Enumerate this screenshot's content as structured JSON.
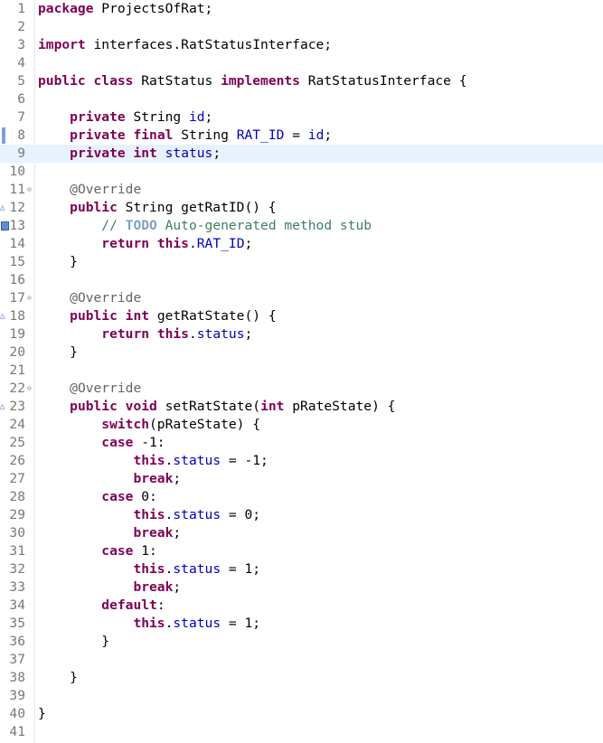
{
  "lines": [
    {
      "num": "1",
      "marker": "",
      "fold": "",
      "tokens": [
        {
          "t": "k",
          "v": "package"
        },
        {
          "t": "p",
          "v": " ProjectsOfRat;"
        }
      ]
    },
    {
      "num": "2",
      "marker": "",
      "fold": "",
      "tokens": []
    },
    {
      "num": "3",
      "marker": "",
      "fold": "",
      "tokens": [
        {
          "t": "k",
          "v": "import"
        },
        {
          "t": "p",
          "v": " interfaces.RatStatusInterface;"
        }
      ]
    },
    {
      "num": "4",
      "marker": "",
      "fold": "",
      "tokens": []
    },
    {
      "num": "5",
      "marker": "",
      "fold": "",
      "tokens": [
        {
          "t": "k",
          "v": "public"
        },
        {
          "t": "p",
          "v": " "
        },
        {
          "t": "k",
          "v": "class"
        },
        {
          "t": "p",
          "v": " RatStatus "
        },
        {
          "t": "k",
          "v": "implements"
        },
        {
          "t": "p",
          "v": " RatStatusInterface {"
        }
      ]
    },
    {
      "num": "6",
      "marker": "",
      "fold": "",
      "tokens": []
    },
    {
      "num": "7",
      "marker": "",
      "fold": "",
      "tokens": [
        {
          "t": "p",
          "v": "    "
        },
        {
          "t": "k",
          "v": "private"
        },
        {
          "t": "p",
          "v": " String "
        },
        {
          "t": "f",
          "v": "id"
        },
        {
          "t": "p",
          "v": ";"
        }
      ]
    },
    {
      "num": "8",
      "marker": "bookmark",
      "fold": "",
      "tokens": [
        {
          "t": "p",
          "v": "    "
        },
        {
          "t": "k",
          "v": "private"
        },
        {
          "t": "p",
          "v": " "
        },
        {
          "t": "k",
          "v": "final"
        },
        {
          "t": "p",
          "v": " String "
        },
        {
          "t": "f",
          "v": "RAT_ID"
        },
        {
          "t": "p",
          "v": " = "
        },
        {
          "t": "f",
          "v": "id"
        },
        {
          "t": "p",
          "v": ";"
        }
      ]
    },
    {
      "num": "9",
      "marker": "",
      "fold": "",
      "current": true,
      "tokens": [
        {
          "t": "p",
          "v": "    "
        },
        {
          "t": "k",
          "v": "private"
        },
        {
          "t": "p",
          "v": " "
        },
        {
          "t": "k",
          "v": "int"
        },
        {
          "t": "p",
          "v": " "
        },
        {
          "t": "f",
          "v": "status"
        },
        {
          "t": "p",
          "v": ";"
        }
      ]
    },
    {
      "num": "10",
      "marker": "",
      "fold": "",
      "tokens": []
    },
    {
      "num": "11",
      "marker": "",
      "fold": "⊖",
      "tokens": [
        {
          "t": "p",
          "v": "    "
        },
        {
          "t": "a",
          "v": "@Override"
        }
      ]
    },
    {
      "num": "12",
      "marker": "override",
      "fold": "",
      "tokens": [
        {
          "t": "p",
          "v": "    "
        },
        {
          "t": "k",
          "v": "public"
        },
        {
          "t": "p",
          "v": " String getRatID() {"
        }
      ]
    },
    {
      "num": "13",
      "marker": "todo",
      "fold": "",
      "tokens": [
        {
          "t": "p",
          "v": "        "
        },
        {
          "t": "c",
          "v": "// "
        },
        {
          "t": "t",
          "v": "TODO"
        },
        {
          "t": "c",
          "v": " Auto-generated method stub"
        }
      ]
    },
    {
      "num": "14",
      "marker": "",
      "fold": "",
      "tokens": [
        {
          "t": "p",
          "v": "        "
        },
        {
          "t": "k",
          "v": "return"
        },
        {
          "t": "p",
          "v": " "
        },
        {
          "t": "k",
          "v": "this"
        },
        {
          "t": "p",
          "v": "."
        },
        {
          "t": "f",
          "v": "RAT_ID"
        },
        {
          "t": "p",
          "v": ";"
        }
      ]
    },
    {
      "num": "15",
      "marker": "",
      "fold": "",
      "tokens": [
        {
          "t": "p",
          "v": "    }"
        }
      ]
    },
    {
      "num": "16",
      "marker": "",
      "fold": "",
      "tokens": []
    },
    {
      "num": "17",
      "marker": "",
      "fold": "⊖",
      "tokens": [
        {
          "t": "p",
          "v": "    "
        },
        {
          "t": "a",
          "v": "@Override"
        }
      ]
    },
    {
      "num": "18",
      "marker": "override",
      "fold": "",
      "tokens": [
        {
          "t": "p",
          "v": "    "
        },
        {
          "t": "k",
          "v": "public"
        },
        {
          "t": "p",
          "v": " "
        },
        {
          "t": "k",
          "v": "int"
        },
        {
          "t": "p",
          "v": " getRatState() {"
        }
      ]
    },
    {
      "num": "19",
      "marker": "",
      "fold": "",
      "tokens": [
        {
          "t": "p",
          "v": "        "
        },
        {
          "t": "k",
          "v": "return"
        },
        {
          "t": "p",
          "v": " "
        },
        {
          "t": "k",
          "v": "this"
        },
        {
          "t": "p",
          "v": "."
        },
        {
          "t": "f",
          "v": "status"
        },
        {
          "t": "p",
          "v": ";"
        }
      ]
    },
    {
      "num": "20",
      "marker": "",
      "fold": "",
      "tokens": [
        {
          "t": "p",
          "v": "    }"
        }
      ]
    },
    {
      "num": "21",
      "marker": "",
      "fold": "",
      "tokens": []
    },
    {
      "num": "22",
      "marker": "",
      "fold": "⊖",
      "tokens": [
        {
          "t": "p",
          "v": "    "
        },
        {
          "t": "a",
          "v": "@Override"
        }
      ]
    },
    {
      "num": "23",
      "marker": "override",
      "fold": "",
      "tokens": [
        {
          "t": "p",
          "v": "    "
        },
        {
          "t": "k",
          "v": "public"
        },
        {
          "t": "p",
          "v": " "
        },
        {
          "t": "k",
          "v": "void"
        },
        {
          "t": "p",
          "v": " setRatState("
        },
        {
          "t": "k",
          "v": "int"
        },
        {
          "t": "p",
          "v": " pRateState) {"
        }
      ]
    },
    {
      "num": "24",
      "marker": "",
      "fold": "",
      "tokens": [
        {
          "t": "p",
          "v": "        "
        },
        {
          "t": "k",
          "v": "switch"
        },
        {
          "t": "p",
          "v": "(pRateState) {"
        }
      ]
    },
    {
      "num": "25",
      "marker": "",
      "fold": "",
      "tokens": [
        {
          "t": "p",
          "v": "        "
        },
        {
          "t": "k",
          "v": "case"
        },
        {
          "t": "p",
          "v": " -1:"
        }
      ]
    },
    {
      "num": "26",
      "marker": "",
      "fold": "",
      "tokens": [
        {
          "t": "p",
          "v": "            "
        },
        {
          "t": "k",
          "v": "this"
        },
        {
          "t": "p",
          "v": "."
        },
        {
          "t": "f",
          "v": "status"
        },
        {
          "t": "p",
          "v": " = -1;"
        }
      ]
    },
    {
      "num": "27",
      "marker": "",
      "fold": "",
      "tokens": [
        {
          "t": "p",
          "v": "            "
        },
        {
          "t": "k",
          "v": "break"
        },
        {
          "t": "p",
          "v": ";"
        }
      ]
    },
    {
      "num": "28",
      "marker": "",
      "fold": "",
      "tokens": [
        {
          "t": "p",
          "v": "        "
        },
        {
          "t": "k",
          "v": "case"
        },
        {
          "t": "p",
          "v": " 0:"
        }
      ]
    },
    {
      "num": "29",
      "marker": "",
      "fold": "",
      "tokens": [
        {
          "t": "p",
          "v": "            "
        },
        {
          "t": "k",
          "v": "this"
        },
        {
          "t": "p",
          "v": "."
        },
        {
          "t": "f",
          "v": "status"
        },
        {
          "t": "p",
          "v": " = 0;"
        }
      ]
    },
    {
      "num": "30",
      "marker": "",
      "fold": "",
      "tokens": [
        {
          "t": "p",
          "v": "            "
        },
        {
          "t": "k",
          "v": "break"
        },
        {
          "t": "p",
          "v": ";"
        }
      ]
    },
    {
      "num": "31",
      "marker": "",
      "fold": "",
      "tokens": [
        {
          "t": "p",
          "v": "        "
        },
        {
          "t": "k",
          "v": "case"
        },
        {
          "t": "p",
          "v": " 1:"
        }
      ]
    },
    {
      "num": "32",
      "marker": "",
      "fold": "",
      "tokens": [
        {
          "t": "p",
          "v": "            "
        },
        {
          "t": "k",
          "v": "this"
        },
        {
          "t": "p",
          "v": "."
        },
        {
          "t": "f",
          "v": "status"
        },
        {
          "t": "p",
          "v": " = 1;"
        }
      ]
    },
    {
      "num": "33",
      "marker": "",
      "fold": "",
      "tokens": [
        {
          "t": "p",
          "v": "            "
        },
        {
          "t": "k",
          "v": "break"
        },
        {
          "t": "p",
          "v": ";"
        }
      ]
    },
    {
      "num": "34",
      "marker": "",
      "fold": "",
      "tokens": [
        {
          "t": "p",
          "v": "        "
        },
        {
          "t": "k",
          "v": "default"
        },
        {
          "t": "p",
          "v": ":"
        }
      ]
    },
    {
      "num": "35",
      "marker": "",
      "fold": "",
      "tokens": [
        {
          "t": "p",
          "v": "            "
        },
        {
          "t": "k",
          "v": "this"
        },
        {
          "t": "p",
          "v": "."
        },
        {
          "t": "f",
          "v": "status"
        },
        {
          "t": "p",
          "v": " = 1;"
        }
      ]
    },
    {
      "num": "36",
      "marker": "",
      "fold": "",
      "tokens": [
        {
          "t": "p",
          "v": "        }"
        }
      ]
    },
    {
      "num": "37",
      "marker": "",
      "fold": "",
      "tokens": []
    },
    {
      "num": "38",
      "marker": "",
      "fold": "",
      "tokens": [
        {
          "t": "p",
          "v": "    }"
        }
      ]
    },
    {
      "num": "39",
      "marker": "",
      "fold": "",
      "tokens": []
    },
    {
      "num": "40",
      "marker": "",
      "fold": "",
      "tokens": [
        {
          "t": "p",
          "v": "}"
        }
      ]
    },
    {
      "num": "41",
      "marker": "",
      "fold": "",
      "tokens": []
    }
  ],
  "colors": {
    "keyword": "#7f0055",
    "field": "#0000c0",
    "annotation": "#646464",
    "comment": "#3f7f5f",
    "todo": "#7f9fbf",
    "line_number": "#787878",
    "current_line": "#e8f2fe"
  }
}
